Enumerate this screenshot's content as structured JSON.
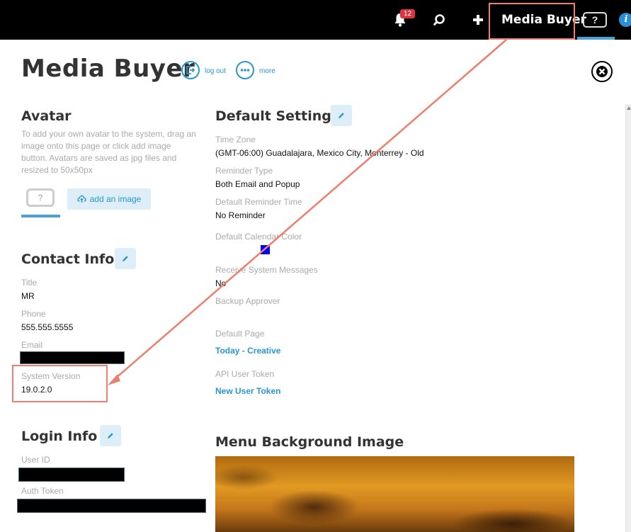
{
  "topbar": {
    "notification_count": "12",
    "user_name": "Media Buyer",
    "help_label": "?",
    "info_label": "i"
  },
  "header": {
    "title": "Media Buyer",
    "logout_label": "log out",
    "more_label": "more"
  },
  "avatar": {
    "title": "Avatar",
    "description": "To add your own avatar to the system, drag an image onto this page or click add image button. Avatars are saved as jpg files and resized to 50x50px",
    "placeholder_label": "?",
    "add_image_label": "add an image"
  },
  "contact_info": {
    "title": "Contact Info",
    "title_label": "Title",
    "title_value": "MR",
    "phone_label": "Phone",
    "phone_value": "555.555.5555",
    "email_label": "Email",
    "system_version_label": "System Version",
    "system_version_value": "19.0.2.0"
  },
  "login_info": {
    "title": "Login Info",
    "user_id_label": "User ID",
    "auth_token_label": "Auth Token"
  },
  "default_settings": {
    "title": "Default Settings",
    "time_zone_label": "Time Zone",
    "time_zone_value": "(GMT-06:00) Guadalajara, Mexico City, Monterrey - Old",
    "reminder_type_label": "Reminder Type",
    "reminder_type_value": "Both Email and Popup",
    "default_reminder_time_label": "Default Reminder Time",
    "default_reminder_time_value": "No Reminder",
    "default_calendar_color_label": "Default Calendar Color",
    "default_calendar_color": "#0000ee",
    "receive_system_messages_label": "Receive System Messages",
    "receive_system_messages_value": "No",
    "backup_approver_label": "Backup Approver",
    "default_page_label": "Default Page",
    "default_page_value": "Today - Creative",
    "api_user_token_label": "API User Token",
    "api_user_token_value": "New User Token"
  },
  "menu_background": {
    "title": "Menu Background Image"
  },
  "colors": {
    "accent": "#2a96cf",
    "annotation": "#ec7f6d",
    "topbar": "#000000"
  }
}
